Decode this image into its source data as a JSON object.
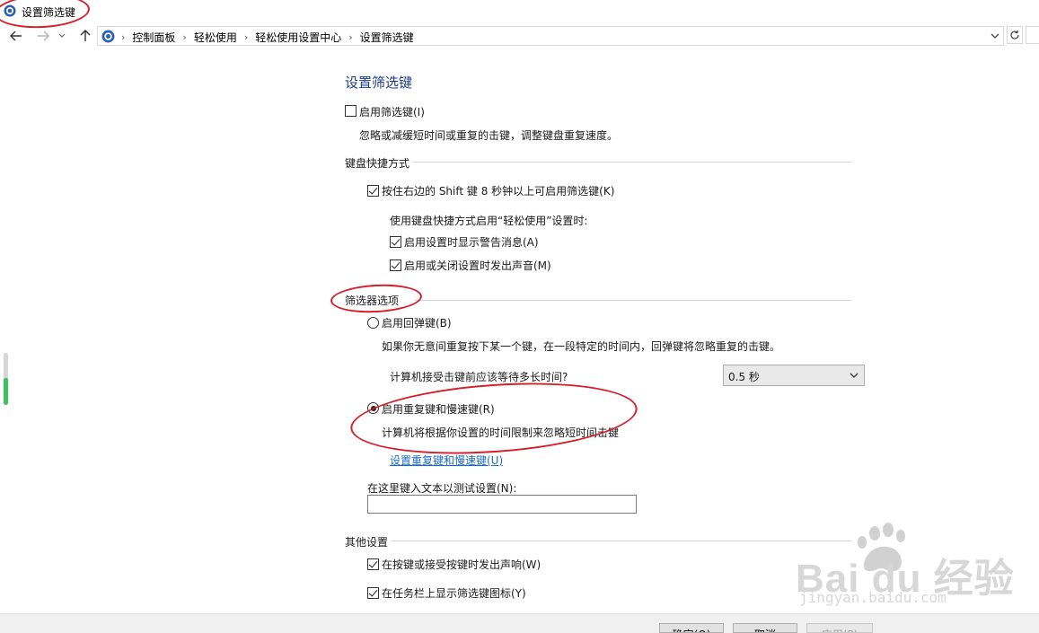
{
  "window": {
    "title": "设置筛选键"
  },
  "breadcrumb": [
    "控制面板",
    "轻松使用",
    "轻松使用设置中心",
    "设置筛选键"
  ],
  "page": {
    "heading": "设置筛选键",
    "enable_filter": {
      "label": "启用筛选键(I)",
      "checked": false
    },
    "enable_filter_desc": "忽略或减缓短时间或重复的击键，调整键盘重复速度。",
    "shortcut_section": "键盘快捷方式",
    "shift_option": {
      "label": "按住右边的 Shift 键 8 秒钟以上可启用筛选键(K)",
      "checked": true
    },
    "shortcut_when": "使用键盘快捷方式启用“轻松使用”设置时:",
    "warn_option": {
      "label": "启用设置时显示警告消息(A)",
      "checked": true
    },
    "sound_option": {
      "label": "启用或关闭设置时发出声音(M)",
      "checked": true
    },
    "filter_section": "筛选器选项",
    "bounce_option": {
      "label": "启用回弹键(B)",
      "checked": false
    },
    "bounce_desc": "如果你无意间重复按下某一个键，在一段特定的时间内，回弹键将忽略重复的击键。",
    "wait_question": "计算机接受击键前应该等待多长时间?",
    "wait_select": {
      "value": "0.5 秒"
    },
    "repeat_option": {
      "label": "启用重复键和慢速键(R)",
      "checked": true
    },
    "repeat_desc": "计算机将根据你设置的时间限制来忽略短时间击键",
    "repeat_link": "设置重复键和慢速键(U)",
    "test_label": "在这里键入文本以测试设置(N):",
    "test_value": "",
    "other_section": "其他设置",
    "beep_option": {
      "label": "在按键或接受按键时发出声响(W)",
      "checked": true
    },
    "tray_option": {
      "label": "在任务栏上显示筛选键图标(Y)",
      "checked": true
    }
  },
  "buttons": {
    "ok": "确定(O)",
    "cancel": "取消",
    "apply": "应用(P)"
  },
  "colors": {
    "heading": "#1e3c8c",
    "link": "#1a6bc9",
    "annotation": "#d5202a",
    "progress": "#3fc15a"
  },
  "watermark": {
    "brand": "Bai du 经验",
    "url": "jingyan.baidu.com"
  }
}
